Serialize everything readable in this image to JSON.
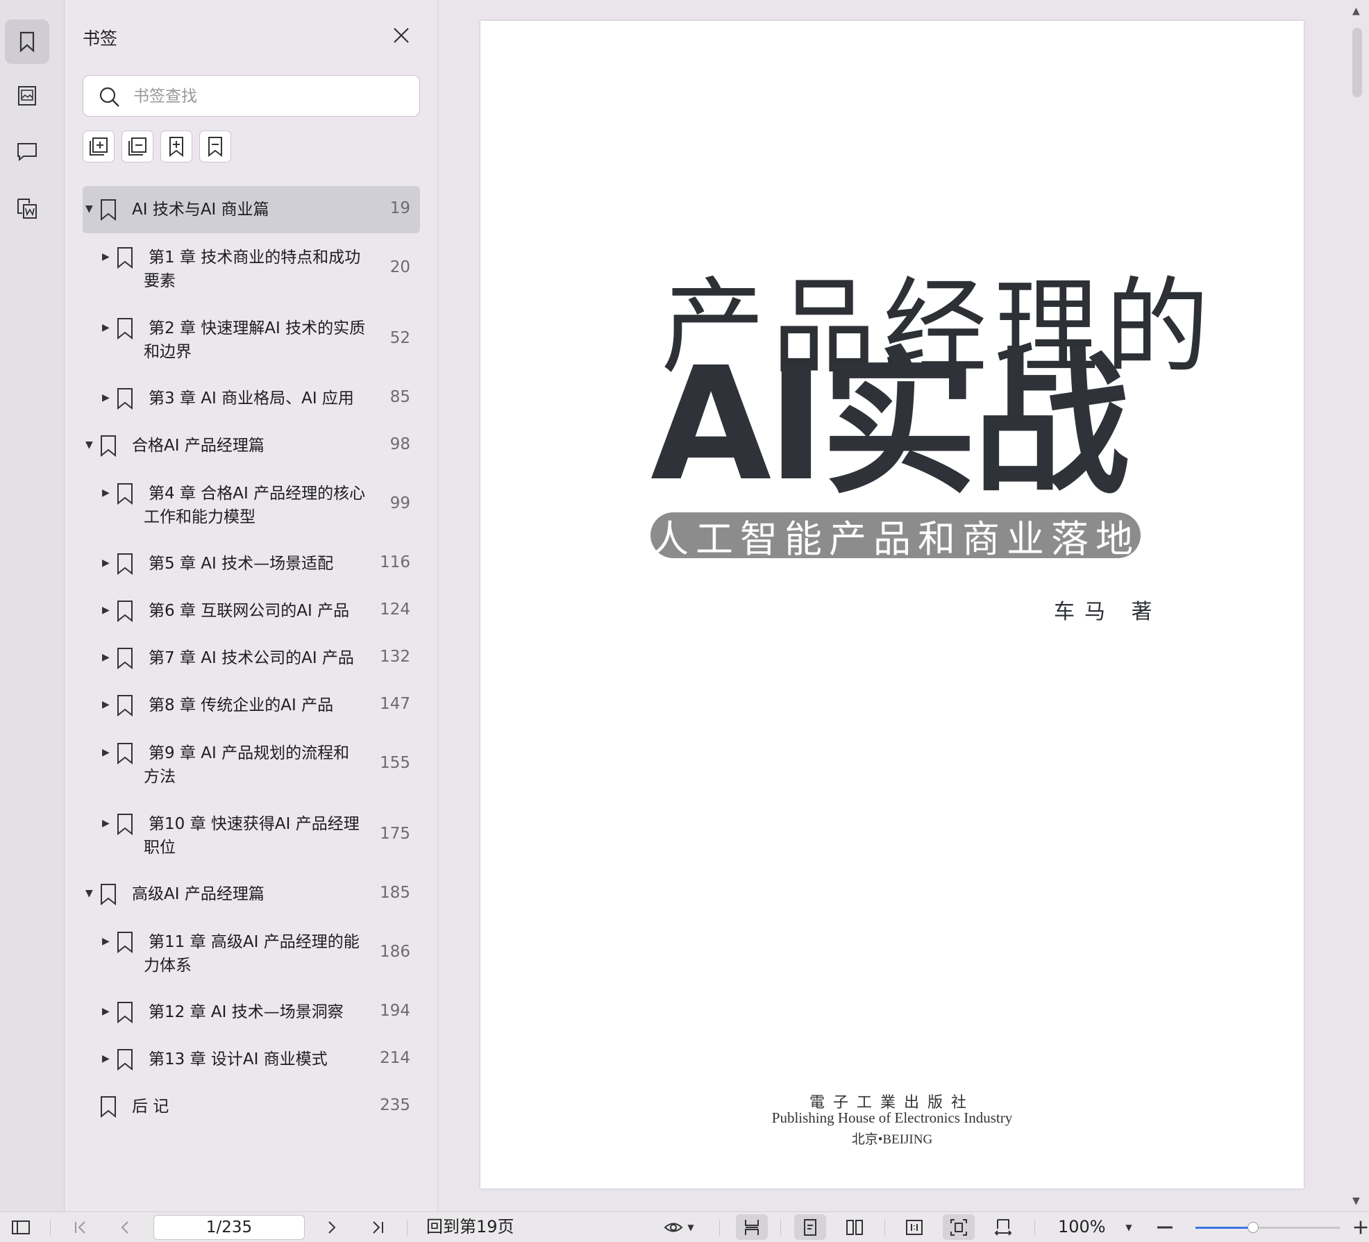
{
  "rail": {
    "items": [
      {
        "icon": "bookmark-icon",
        "active": true
      },
      {
        "icon": "thumbnail-image-icon",
        "active": false
      },
      {
        "icon": "comment-icon",
        "active": false
      },
      {
        "icon": "convert-word-icon",
        "active": false
      }
    ]
  },
  "panel": {
    "title": "书签",
    "search_placeholder": "书签查找",
    "tools": [
      "expand-all-icon",
      "collapse-all-icon",
      "add-bookmark-icon",
      "remove-bookmark-icon"
    ]
  },
  "bookmarks": [
    {
      "level": 0,
      "arrow": "▼",
      "lines": [
        "AI 技术与AI 商业篇"
      ],
      "page": "19",
      "selected": true
    },
    {
      "level": 1,
      "arrow": "▶",
      "lines": [
        "第1 章 技术商业的特点和成功",
        "要素"
      ],
      "page": "20"
    },
    {
      "level": 1,
      "arrow": "▶",
      "lines": [
        "第2 章 快速理解AI 技术的实质",
        "和边界"
      ],
      "page": "52"
    },
    {
      "level": 1,
      "arrow": "▶",
      "lines": [
        "第3 章 AI 商业格局、AI 应用"
      ],
      "page": "85"
    },
    {
      "level": 0,
      "arrow": "▼",
      "lines": [
        "合格AI 产品经理篇"
      ],
      "page": "98"
    },
    {
      "level": 1,
      "arrow": "▶",
      "lines": [
        "第4 章 合格AI 产品经理的核心",
        "工作和能力模型"
      ],
      "page": "99"
    },
    {
      "level": 1,
      "arrow": "▶",
      "lines": [
        "第5 章 AI 技术—场景适配"
      ],
      "page": "116"
    },
    {
      "level": 1,
      "arrow": "▶",
      "lines": [
        "第6 章 互联网公司的AI 产品"
      ],
      "page": "124"
    },
    {
      "level": 1,
      "arrow": "▶",
      "lines": [
        "第7 章 AI 技术公司的AI 产品"
      ],
      "page": "132"
    },
    {
      "level": 1,
      "arrow": "▶",
      "lines": [
        "第8 章 传统企业的AI 产品"
      ],
      "page": "147"
    },
    {
      "level": 1,
      "arrow": "▶",
      "lines": [
        "第9 章 AI 产品规划的流程和",
        "方法"
      ],
      "page": "155"
    },
    {
      "level": 1,
      "arrow": "▶",
      "lines": [
        "第10 章 快速获得AI 产品经理",
        "职位"
      ],
      "page": "175"
    },
    {
      "level": 0,
      "arrow": "▼",
      "lines": [
        "高级AI 产品经理篇"
      ],
      "page": "185"
    },
    {
      "level": 1,
      "arrow": "▶",
      "lines": [
        "第11 章 高级AI 产品经理的能",
        "力体系"
      ],
      "page": "186"
    },
    {
      "level": 1,
      "arrow": "▶",
      "lines": [
        "第12 章 AI 技术—场景洞察"
      ],
      "page": "194"
    },
    {
      "level": 1,
      "arrow": "▶",
      "lines": [
        "第13 章 设计AI 商业模式"
      ],
      "page": "214"
    },
    {
      "level": 0,
      "arrow": "",
      "lines": [
        "后 记"
      ],
      "page": "235"
    }
  ],
  "cover": {
    "title_line1": "产品经理的",
    "title_line2": "AI实战",
    "subtitle": "人工智能产品和商业落地",
    "author": "车马 著",
    "publisher_cn": "電子工業出版社",
    "publisher_en": "Publishing House of Electronics Industry",
    "publisher_city": "北京•BEIJING"
  },
  "statusbar": {
    "page_value": "1/235",
    "goto_label": "回到第19页",
    "zoom": "100%",
    "zoom_level": 0.4
  }
}
